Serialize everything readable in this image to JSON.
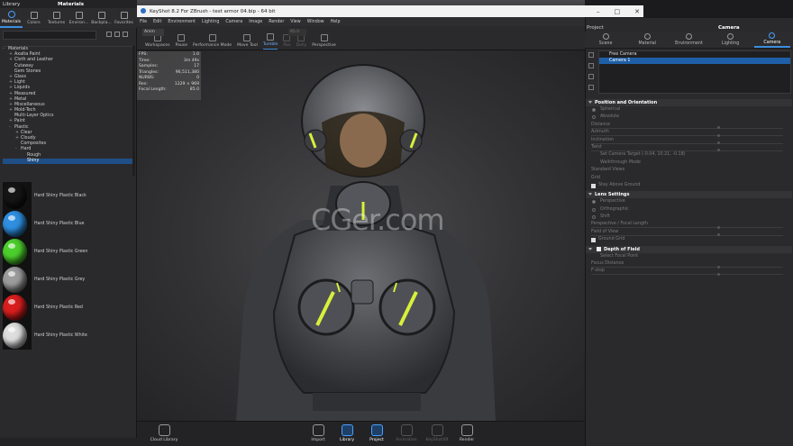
{
  "left_panel": {
    "title_library": "Library",
    "title_section": "Materials",
    "tabs": [
      {
        "label": "Materials",
        "icon": "materials-icon",
        "active": true
      },
      {
        "label": "Colors",
        "icon": "colors-icon",
        "active": false
      },
      {
        "label": "Textures",
        "icon": "textures-icon",
        "active": false
      },
      {
        "label": "Environ...",
        "icon": "environments-icon",
        "active": false
      },
      {
        "label": "Backpla...",
        "icon": "backplates-icon",
        "active": false
      },
      {
        "label": "Favorites",
        "icon": "favorites-icon",
        "active": false
      }
    ],
    "tree": [
      {
        "label": "Materials",
        "level": 0,
        "toggle": "-"
      },
      {
        "label": "Axalta Paint",
        "level": 1,
        "toggle": "+"
      },
      {
        "label": "Cloth and Leather",
        "level": 1,
        "toggle": "+"
      },
      {
        "label": "Cutaway",
        "level": 1,
        "toggle": ""
      },
      {
        "label": "Gem Stones",
        "level": 1,
        "toggle": ""
      },
      {
        "label": "Glass",
        "level": 1,
        "toggle": "+"
      },
      {
        "label": "Light",
        "level": 1,
        "toggle": "+"
      },
      {
        "label": "Liquids",
        "level": 1,
        "toggle": "+"
      },
      {
        "label": "Measured",
        "level": 1,
        "toggle": "+"
      },
      {
        "label": "Metal",
        "level": 1,
        "toggle": "+"
      },
      {
        "label": "Miscellaneous",
        "level": 1,
        "toggle": "+"
      },
      {
        "label": "Mold-Tech",
        "level": 1,
        "toggle": "+"
      },
      {
        "label": "Multi-Layer Optics",
        "level": 1,
        "toggle": ""
      },
      {
        "label": "Paint",
        "level": 1,
        "toggle": "+"
      },
      {
        "label": "Plastic",
        "level": 1,
        "toggle": "-"
      },
      {
        "label": "Clear",
        "level": 2,
        "toggle": "+"
      },
      {
        "label": "Cloudy",
        "level": 2,
        "toggle": "+"
      },
      {
        "label": "Composites",
        "level": 2,
        "toggle": ""
      },
      {
        "label": "Hard",
        "level": 2,
        "toggle": "-"
      },
      {
        "label": "Rough",
        "level": 3,
        "toggle": ""
      },
      {
        "label": "Shiny",
        "level": 3,
        "toggle": "",
        "selected": true
      }
    ],
    "materials": [
      {
        "label": "Hard Shiny Plastic Black",
        "color": "#151515"
      },
      {
        "label": "Hard Shiny Plastic Blue",
        "color": "#2f8fe0"
      },
      {
        "label": "Hard Shiny Plastic Green",
        "color": "#4ccf2c"
      },
      {
        "label": "Hard Shiny Plastic Grey",
        "color": "#9c9c9c"
      },
      {
        "label": "Hard Shiny Plastic Red",
        "color": "#d81e1e"
      },
      {
        "label": "Hard Shiny Plastic White",
        "color": "#dedede"
      }
    ]
  },
  "window": {
    "title": "KeyShot 8.2 For ZBrush - test armor 04.bip - 64 bit",
    "menu": [
      "File",
      "Edit",
      "Environment",
      "Lighting",
      "Camera",
      "Image",
      "Render",
      "View",
      "Window",
      "Help"
    ]
  },
  "toolbar": {
    "anim_value": "Anim",
    "fov_value": "85.0",
    "buttons": [
      {
        "label": "Workspaces",
        "icon": "workspaces-icon",
        "state": "normal"
      },
      {
        "label": "Pause",
        "icon": "pause-icon",
        "state": "normal"
      },
      {
        "label": "Performance Mode",
        "icon": "performance-icon",
        "state": "normal"
      },
      {
        "label": "Move Tool",
        "icon": "move-tool-icon",
        "state": "normal"
      },
      {
        "label": "Tumble",
        "icon": "tumble-icon",
        "state": "active"
      },
      {
        "label": "Pan",
        "icon": "pan-icon",
        "state": "disabled"
      },
      {
        "label": "Dolly",
        "icon": "dolly-icon",
        "state": "disabled"
      },
      {
        "label": "Perspective",
        "icon": "perspective-icon",
        "state": "normal"
      }
    ]
  },
  "hud": [
    {
      "k": "FPS:",
      "v": "1.0"
    },
    {
      "k": "Time:",
      "v": "3m 49s"
    },
    {
      "k": "Samples:",
      "v": "17"
    },
    {
      "k": "Triangles:",
      "v": "96,511,380"
    },
    {
      "k": "NURBS:",
      "v": "0"
    },
    {
      "k": "Res:",
      "v": "1229 × 969"
    },
    {
      "k": "Focal Length:",
      "v": "85.0"
    }
  ],
  "watermark": "CGer.com",
  "bottom_bar": [
    {
      "label": "Cloud Library",
      "icon": "cloud-library-icon",
      "state": "normal"
    },
    {
      "label": "Import",
      "icon": "import-icon",
      "state": "normal"
    },
    {
      "label": "Library",
      "icon": "library-icon",
      "state": "active"
    },
    {
      "label": "Project",
      "icon": "project-icon",
      "state": "active"
    },
    {
      "label": "Animation",
      "icon": "animation-icon",
      "state": "disabled"
    },
    {
      "label": "KeyShotXR",
      "icon": "keyshotxr-icon",
      "state": "disabled"
    },
    {
      "label": "Render",
      "icon": "render-icon",
      "state": "normal"
    }
  ],
  "right_panel": {
    "project_label": "Project",
    "section_title": "Camera",
    "tabs": [
      {
        "label": "Scene",
        "icon": "scene-icon",
        "active": false
      },
      {
        "label": "Material",
        "icon": "material-icon",
        "active": false
      },
      {
        "label": "Environment",
        "icon": "environment-icon",
        "active": false
      },
      {
        "label": "Lighting",
        "icon": "lighting-icon",
        "active": false
      },
      {
        "label": "Camera",
        "icon": "camera-icon",
        "active": true
      }
    ],
    "cameras": [
      {
        "label": "Free Camera",
        "selected": false
      },
      {
        "label": "Camera 1",
        "selected": true
      }
    ],
    "position_section": "Position and Orientation",
    "position_rows": [
      {
        "label": "Spherical",
        "kind": "radio",
        "on": true
      },
      {
        "label": "Absolute",
        "kind": "radio",
        "on": false
      },
      {
        "label": "Distance",
        "kind": "slider"
      },
      {
        "label": "Azimuth",
        "kind": "slider"
      },
      {
        "label": "Inclination",
        "kind": "slider"
      },
      {
        "label": "Twist",
        "kind": "slider"
      },
      {
        "label": "Set Camera Target  (-0.04, 10.21, -0.18)",
        "kind": "button"
      },
      {
        "label": "Walkthrough Mode",
        "kind": "button"
      },
      {
        "label": "Standard Views",
        "kind": "label"
      },
      {
        "label": "Grid",
        "kind": "label"
      },
      {
        "label": "Stay Above Ground",
        "kind": "check"
      }
    ],
    "lens_section": "Lens Settings",
    "lens_rows": [
      {
        "label": "Perspective",
        "kind": "radio",
        "on": true
      },
      {
        "label": "Orthographic",
        "kind": "radio",
        "on": false
      },
      {
        "label": "Shift",
        "kind": "radio",
        "on": false
      },
      {
        "label": "Perspective / Focal Length",
        "kind": "slider"
      },
      {
        "label": "Field of View",
        "kind": "slider"
      },
      {
        "label": "Ground Grid",
        "kind": "check"
      }
    ],
    "dof_section": "Depth of Field",
    "dof_rows": [
      {
        "label": "Select Focal Point",
        "kind": "button"
      },
      {
        "label": "Focus Distance",
        "kind": "slider"
      },
      {
        "label": "F-stop",
        "kind": "slider"
      }
    ]
  }
}
